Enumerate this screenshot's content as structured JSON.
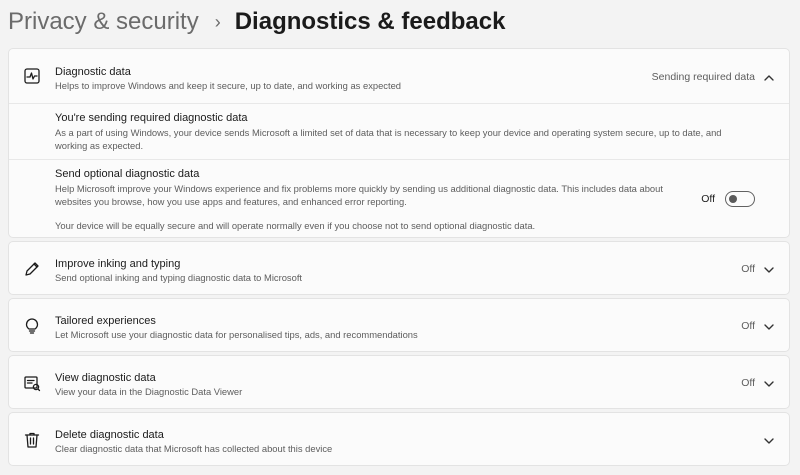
{
  "breadcrumb": {
    "parent": "Privacy & security",
    "separator": "›",
    "current": "Diagnostics & feedback"
  },
  "diagnostic_data": {
    "title": "Diagnostic data",
    "description": "Helps to improve Windows and keep it secure, up to date, and working as expected",
    "status": "Sending required data",
    "icon": "pulse-icon",
    "expanded": true,
    "required": {
      "title": "You're sending required diagnostic data",
      "description": "As a part of using Windows, your device sends Microsoft a limited set of data that is necessary to keep your device and operating system secure, up to date, and working as expected."
    },
    "optional": {
      "title": "Send optional diagnostic data",
      "description": "Help Microsoft improve your Windows experience and fix problems more quickly by sending us additional diagnostic data. This includes data about websites you browse, how you use apps and features, and enhanced error reporting.",
      "note": "Your device will be equally secure and will operate normally even if you choose not to send optional diagnostic data.",
      "toggle_label": "Off",
      "toggle_on": false
    }
  },
  "inking": {
    "title": "Improve inking and typing",
    "description": "Send optional inking and typing diagnostic data to Microsoft",
    "status": "Off",
    "icon": "pen-icon"
  },
  "tailored": {
    "title": "Tailored experiences",
    "description": "Let Microsoft use your diagnostic data for personalised tips, ads, and recommendations",
    "status": "Off",
    "icon": "lightbulb-icon"
  },
  "viewer": {
    "title": "View diagnostic data",
    "description": "View your data in the Diagnostic Data Viewer",
    "status": "Off",
    "icon": "data-viewer-icon"
  },
  "delete": {
    "title": "Delete diagnostic data",
    "description": "Clear diagnostic data that Microsoft has collected about this device",
    "icon": "trash-icon"
  }
}
